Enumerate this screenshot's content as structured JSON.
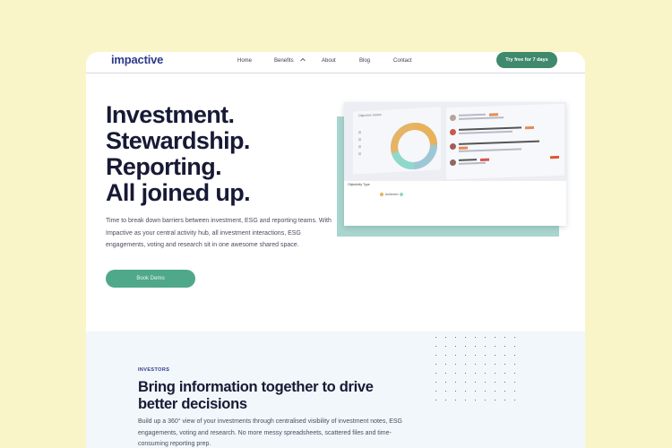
{
  "brand": {
    "logo_text": "impactive",
    "accent": "#2d3a8c",
    "green": "#3f8a6c"
  },
  "nav": {
    "links": [
      "Home",
      "Benefits",
      "About",
      "Blog",
      "Contact"
    ],
    "cta_label": "Try free for 7 days"
  },
  "hero": {
    "headline": [
      "Investment.",
      "Stewardship.",
      "Reporting.",
      "All joined up."
    ],
    "body": "Time to break down barriers between investment, ESG and reporting teams. With Impactive as your central activity hub, all investment interactions, ESG engagements, voting and research sit in one awesome shared space.",
    "button_label": "Book Demo"
  },
  "mockup": {
    "panel_title": "Objective Status",
    "footer_label": "Objectivity Type",
    "legend_label": "Achieved"
  },
  "investors": {
    "eyebrow": "INVESTORS",
    "title": "Bring information together to drive better decisions",
    "body": "Build up a 360° view of your investments through centralised visibility of investment notes, ESG engagements, voting and research. No more messy spreadsheets, scattered files and time-consuming reporting prep."
  },
  "icons": {
    "benefits_dropdown": "chevron-down-icon"
  }
}
